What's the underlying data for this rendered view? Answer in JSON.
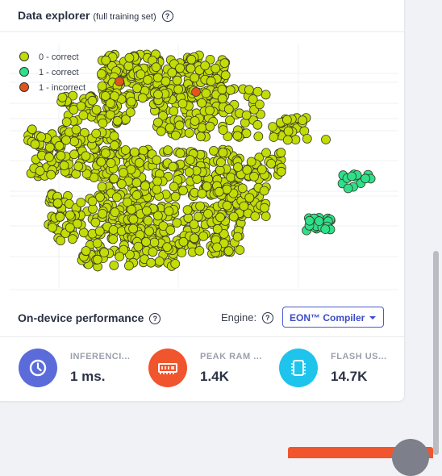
{
  "explorer": {
    "title": "Data explorer",
    "subtitle": "(full training set)",
    "help_icon": "question-circle-icon",
    "legend": [
      {
        "label": "0 - correct",
        "color": "#c2dc06"
      },
      {
        "label": "1 - correct",
        "color": "#2ee08a"
      },
      {
        "label": "1 - incorrect",
        "color": "#e0561a"
      }
    ]
  },
  "performance": {
    "title": "On-device performance",
    "engine_label": "Engine:",
    "engine_value": "EON™ Compiler",
    "metrics": [
      {
        "label": "INFERENCI...",
        "value": "1 ms.",
        "icon": "clock-icon",
        "color": "#5b6bd9"
      },
      {
        "label": "PEAK RAM ...",
        "value": "1.4K",
        "icon": "memory-icon",
        "color": "#f0552d"
      },
      {
        "label": "FLASH US...",
        "value": "14.7K",
        "icon": "chip-icon",
        "color": "#1fc4ec"
      }
    ]
  },
  "colors": {
    "accent": "#3b4bc7",
    "class0": "#c2dc06",
    "class1": "#2ee08a",
    "incorrect": "#e0561a"
  }
}
